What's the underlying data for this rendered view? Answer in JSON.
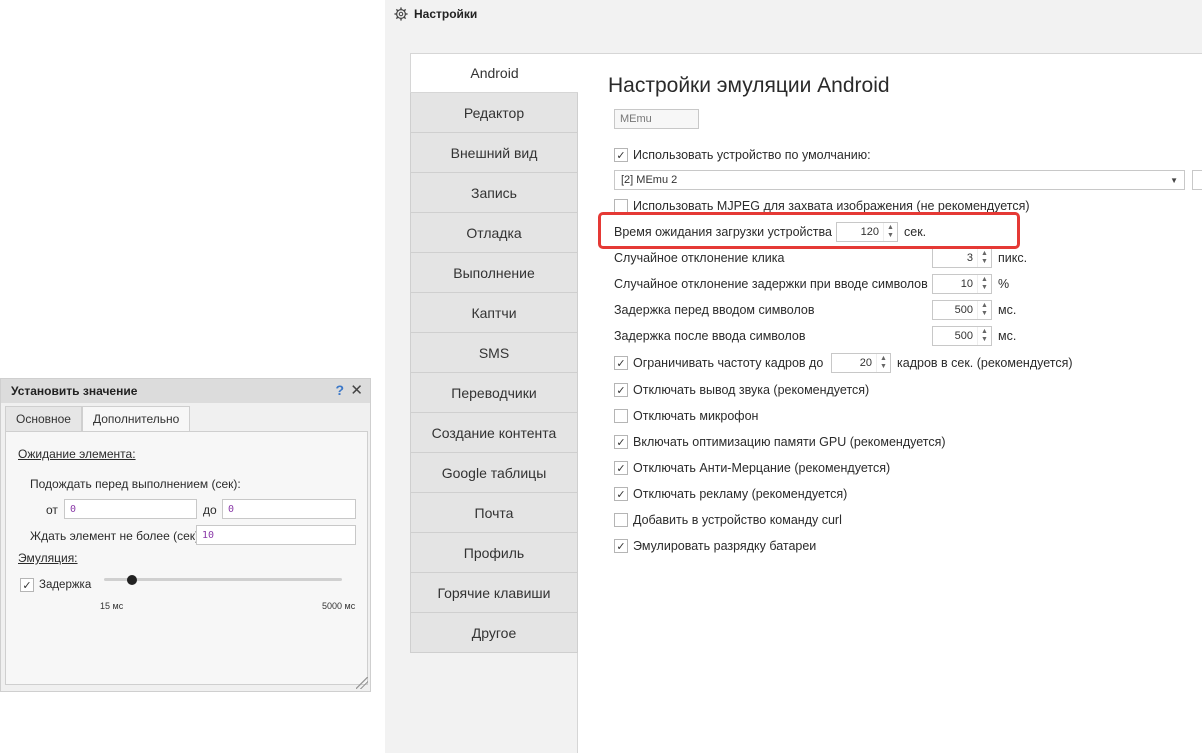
{
  "settings": {
    "window_title": "Настройки",
    "tabs": [
      {
        "label": "Android",
        "active": true
      },
      {
        "label": "Редактор"
      },
      {
        "label": "Внешний вид"
      },
      {
        "label": "Запись"
      },
      {
        "label": "Отладка"
      },
      {
        "label": "Выполнение"
      },
      {
        "label": "Каптчи"
      },
      {
        "label": "SMS"
      },
      {
        "label": "Переводчики"
      },
      {
        "label": "Создание контента"
      },
      {
        "label": "Google таблицы"
      },
      {
        "label": "Почта"
      },
      {
        "label": "Профиль"
      },
      {
        "label": "Горячие клавиши"
      },
      {
        "label": "Другое"
      }
    ],
    "heading": "Настройки эмуляции Android",
    "emulator_name": "MEmu",
    "use_default_device": {
      "label": "Использовать устройство по умолчанию:",
      "checked": true
    },
    "device_select": {
      "value": "[2] MEmu 2"
    },
    "use_mjpeg": {
      "label": "Использовать MJPEG для захвата изображения (не рекомендуется)",
      "checked": false
    },
    "load_timeout": {
      "label": "Время ожидания загрузки устройства",
      "value": "120",
      "unit": "сек."
    },
    "click_deviation": {
      "label": "Случайное отклонение клика",
      "value": "3",
      "unit": "пикс."
    },
    "typing_delay_deviation": {
      "label": "Случайное отклонение задержки при вводе символов",
      "value": "10",
      "unit": "%"
    },
    "delay_before_typing": {
      "label": "Задержка перед вводом символов",
      "value": "500",
      "unit": "мс."
    },
    "delay_after_typing": {
      "label": "Задержка после ввода символов",
      "value": "500",
      "unit": "мс."
    },
    "limit_fps": {
      "label": "Ограничивать частоту кадров до",
      "value": "20",
      "unit": "кадров в сек. (рекомендуется)",
      "checked": true
    },
    "checkboxes": [
      {
        "label": "Отключать вывод звука (рекомендуется)",
        "checked": true
      },
      {
        "label": "Отключать микрофон",
        "checked": false
      },
      {
        "label": "Включать оптимизацию памяти GPU (рекомендуется)",
        "checked": true
      },
      {
        "label": "Отключать Анти-Мерцание (рекомендуется)",
        "checked": true
      },
      {
        "label": "Отключать рекламу (рекомендуется)",
        "checked": true
      },
      {
        "label": "Добавить в устройство команду curl",
        "checked": false
      },
      {
        "label": "Эмулировать разрядку батареи",
        "checked": true
      }
    ],
    "check_mark": "✓",
    "highlight_color": "#e53935"
  },
  "dialog": {
    "title": "Установить значение",
    "help_glyph": "?",
    "close_glyph": "✕",
    "tabs": [
      {
        "label": "Основное",
        "active": false
      },
      {
        "label": "Дополнительно",
        "active": true
      }
    ],
    "wait_section": "Ожидание элемента:",
    "wait_before_label": "Подождать перед выполнением (сек):",
    "from_label": "от",
    "from_value": "0",
    "to_label": "до",
    "to_value": "0",
    "wait_max_label": "Ждать элемент не более (сек):",
    "wait_max_value": "10",
    "emulation_section": "Эмуляция:",
    "delay_label": "Задержка",
    "delay_checked": true,
    "slider_min_label": "15 мс",
    "slider_max_label": "5000 мс",
    "slider_level": 0.01
  }
}
